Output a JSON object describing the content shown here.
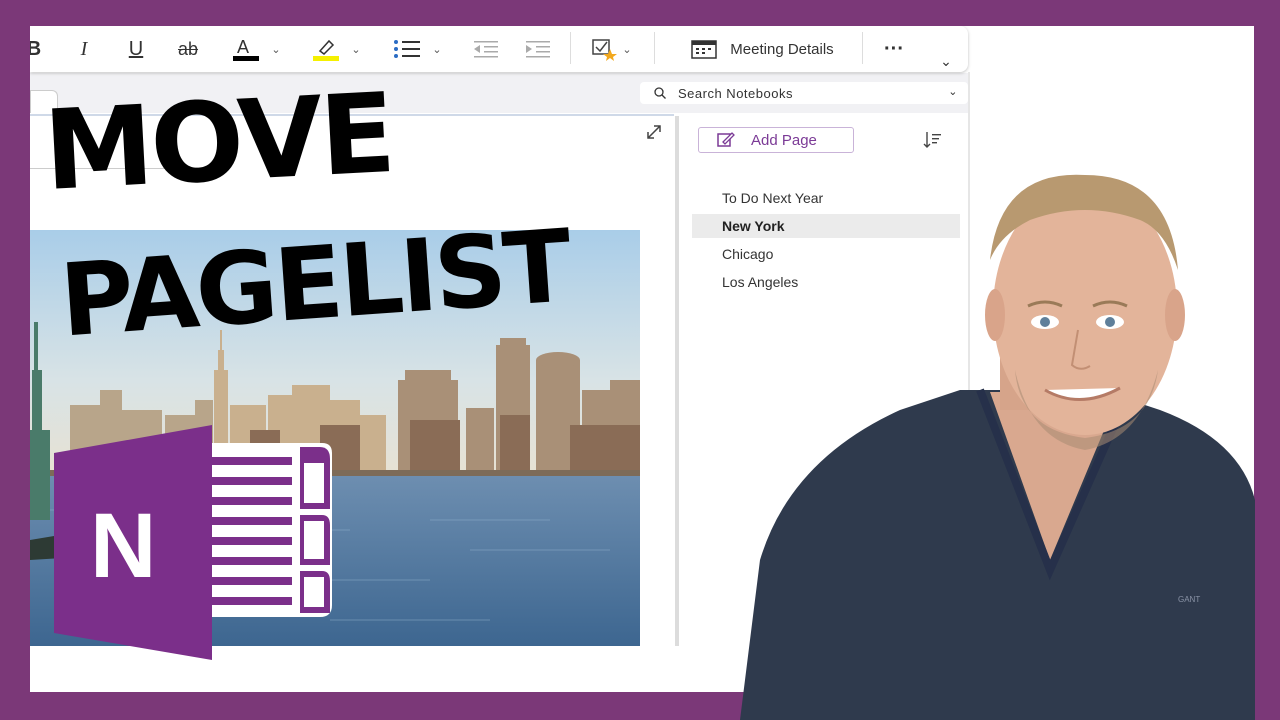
{
  "ribbon": {
    "buttons": [
      {
        "name": "bold-button",
        "glyph": "B"
      },
      {
        "name": "italic-button",
        "glyph": "I"
      },
      {
        "name": "underline-button",
        "glyph": "U"
      },
      {
        "name": "strikethrough-button",
        "glyph": "ab"
      }
    ],
    "meeting_details_label": "Meeting Details",
    "more_label": "···"
  },
  "search": {
    "placeholder": "Search Notebooks"
  },
  "pagelist": {
    "add_page_label": "Add Page",
    "pages": [
      {
        "label": "To Do Next Year",
        "selected": false
      },
      {
        "label": "New York",
        "selected": true
      },
      {
        "label": "Chicago",
        "selected": false
      },
      {
        "label": "Los Angeles",
        "selected": false
      }
    ]
  },
  "overlay": {
    "line1": "MOVE",
    "line2": "PAGELIST",
    "logo_letter": "N"
  },
  "colors": {
    "frame": "#7b3878",
    "accent": "#7b3a96",
    "font_color_bar": "#000000",
    "highlight_bar": "#f5f000",
    "onenote_purple": "#7b2f8a"
  },
  "person": {
    "shirt_logo": "GANT"
  }
}
